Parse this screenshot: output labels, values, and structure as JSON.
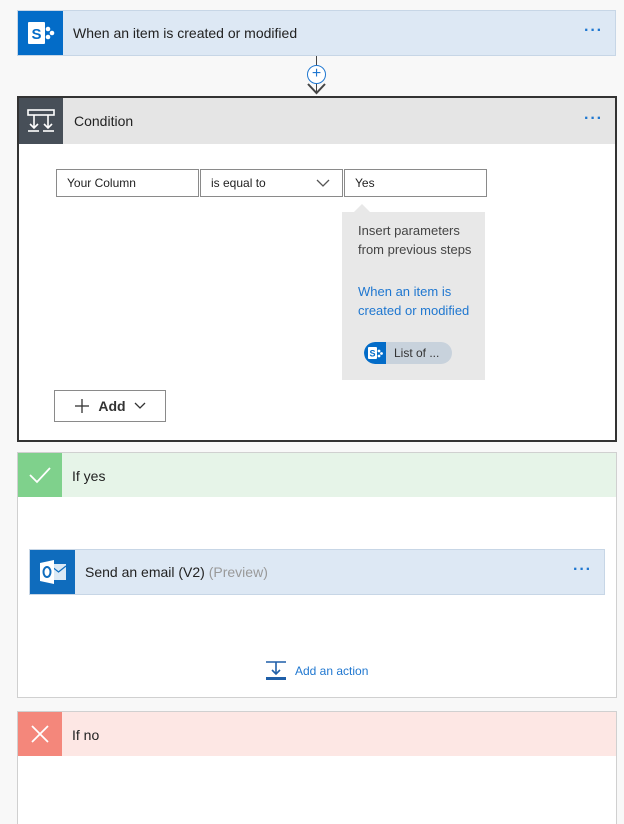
{
  "trigger": {
    "title": "When an item is created or modified",
    "menu": "···",
    "icon": "sharepoint-icon"
  },
  "connector": {
    "plus": "+"
  },
  "condition": {
    "title": "Condition",
    "menu": "···",
    "icon": "condition-icon",
    "left_value": "Your Column",
    "operator": "is equal to",
    "right_value": "Yes",
    "popup": {
      "hint": "Insert parameters from previous steps",
      "source": "When an item is created or modified",
      "chip_label": "List of ..."
    },
    "add_label": "Add"
  },
  "if_yes": {
    "title": "If yes",
    "color": "#7fd18c",
    "action": {
      "title": "Send an email (V2)",
      "badge": "(Preview)",
      "menu": "···",
      "icon": "outlook-icon"
    },
    "add_action_label": "Add an action"
  },
  "if_no": {
    "title": "If no",
    "color": "#f4877b"
  }
}
